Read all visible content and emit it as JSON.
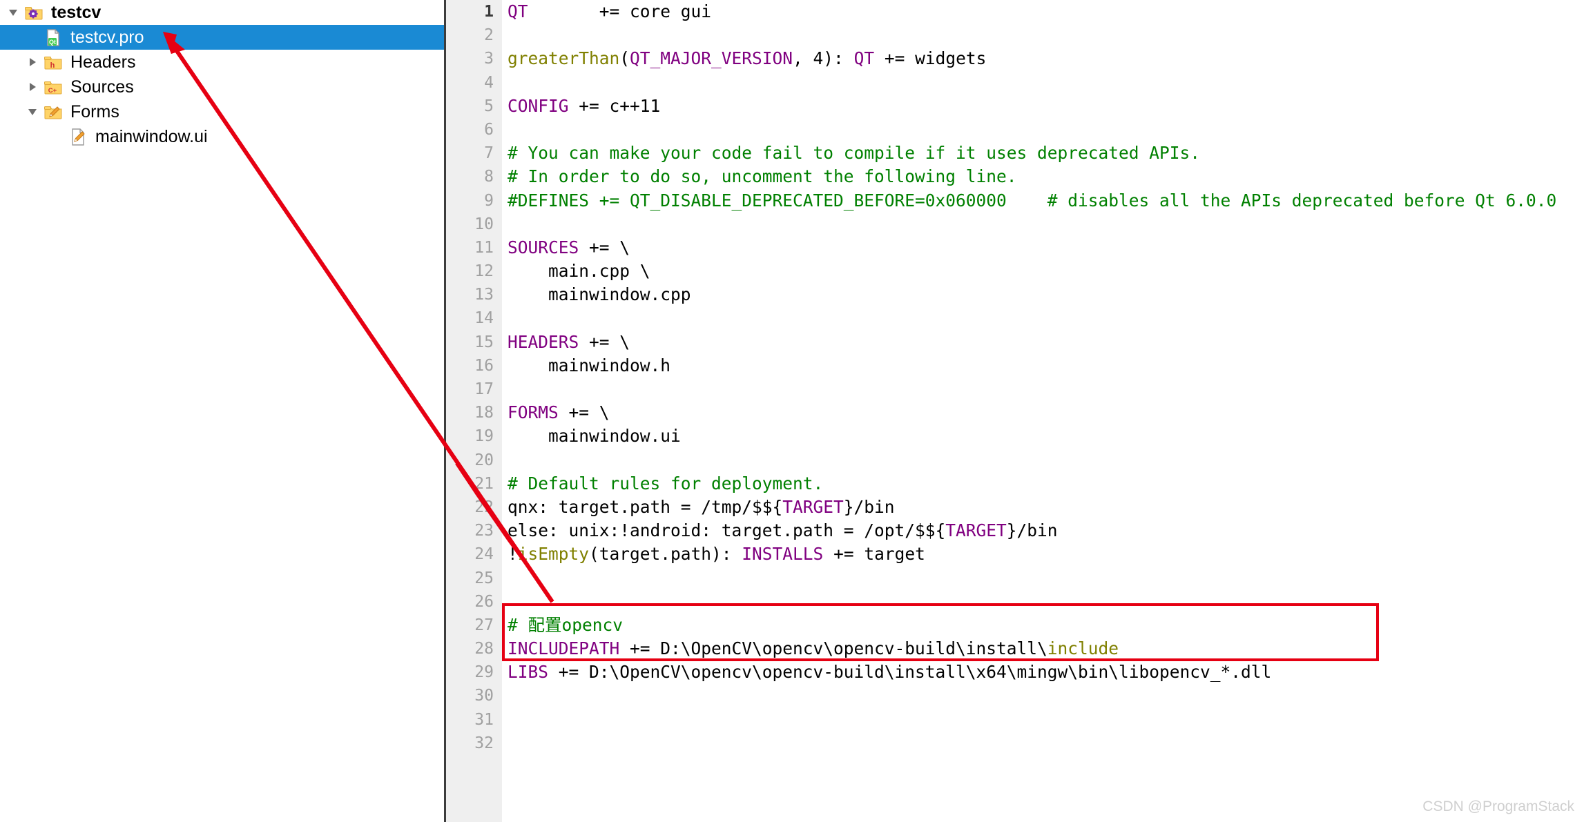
{
  "project_tree": {
    "name": "project-tree-panel",
    "items": [
      {
        "label": "testcv",
        "icon": "qt-project-icon",
        "indent": 0,
        "expander": "down",
        "selected": false,
        "bold": true
      },
      {
        "label": "testcv.pro",
        "icon": "qt-pro-file-icon",
        "indent": 1,
        "expander": "none",
        "selected": true,
        "bold": false
      },
      {
        "label": "Headers",
        "icon": "folder-h-icon",
        "indent": 1,
        "expander": "right",
        "selected": false,
        "bold": false
      },
      {
        "label": "Sources",
        "icon": "folder-cpp-icon",
        "indent": 1,
        "expander": "right",
        "selected": false,
        "bold": false
      },
      {
        "label": "Forms",
        "icon": "folder-ui-icon",
        "indent": 1,
        "expander": "down",
        "selected": false,
        "bold": false
      },
      {
        "label": "mainwindow.ui",
        "icon": "ui-file-icon",
        "indent": 2,
        "expander": "none",
        "selected": false,
        "bold": false
      }
    ]
  },
  "editor": {
    "name": "pro-file-editor",
    "current_line": 1,
    "line_count": 32,
    "lines": [
      {
        "n": 1,
        "tokens": [
          {
            "t": "QT",
            "c": "kw"
          },
          {
            "t": "       += core gui",
            "c": "pl"
          }
        ]
      },
      {
        "n": 2,
        "tokens": []
      },
      {
        "n": 3,
        "tokens": [
          {
            "t": "greaterThan",
            "c": "fn"
          },
          {
            "t": "(",
            "c": "pl"
          },
          {
            "t": "QT_MAJOR_VERSION",
            "c": "kw"
          },
          {
            "t": ", 4): ",
            "c": "pl"
          },
          {
            "t": "QT",
            "c": "kw"
          },
          {
            "t": " += widgets",
            "c": "pl"
          }
        ]
      },
      {
        "n": 4,
        "tokens": []
      },
      {
        "n": 5,
        "tokens": [
          {
            "t": "CONFIG",
            "c": "kw"
          },
          {
            "t": " += c++11",
            "c": "pl"
          }
        ]
      },
      {
        "n": 6,
        "tokens": []
      },
      {
        "n": 7,
        "tokens": [
          {
            "t": "# You can make your code fail to compile if it uses deprecated APIs.",
            "c": "cm"
          }
        ]
      },
      {
        "n": 8,
        "tokens": [
          {
            "t": "# In order to do so, uncomment the following line.",
            "c": "cm"
          }
        ]
      },
      {
        "n": 9,
        "tokens": [
          {
            "t": "#DEFINES += QT_DISABLE_DEPRECATED_BEFORE=0x060000    # disables all the APIs deprecated before Qt 6.0.0",
            "c": "cm"
          }
        ]
      },
      {
        "n": 10,
        "tokens": []
      },
      {
        "n": 11,
        "tokens": [
          {
            "t": "SOURCES",
            "c": "kw"
          },
          {
            "t": " += \\",
            "c": "pl"
          }
        ]
      },
      {
        "n": 12,
        "tokens": [
          {
            "t": "    main.cpp \\",
            "c": "pl"
          }
        ]
      },
      {
        "n": 13,
        "tokens": [
          {
            "t": "    mainwindow.cpp",
            "c": "pl"
          }
        ]
      },
      {
        "n": 14,
        "tokens": []
      },
      {
        "n": 15,
        "tokens": [
          {
            "t": "HEADERS",
            "c": "kw"
          },
          {
            "t": " += \\",
            "c": "pl"
          }
        ]
      },
      {
        "n": 16,
        "tokens": [
          {
            "t": "    mainwindow.h",
            "c": "pl"
          }
        ]
      },
      {
        "n": 17,
        "tokens": []
      },
      {
        "n": 18,
        "tokens": [
          {
            "t": "FORMS",
            "c": "kw"
          },
          {
            "t": " += \\",
            "c": "pl"
          }
        ]
      },
      {
        "n": 19,
        "tokens": [
          {
            "t": "    mainwindow.ui",
            "c": "pl"
          }
        ]
      },
      {
        "n": 20,
        "tokens": []
      },
      {
        "n": 21,
        "tokens": [
          {
            "t": "# Default rules for deployment.",
            "c": "cm"
          }
        ]
      },
      {
        "n": 22,
        "tokens": [
          {
            "t": "qnx: target.path = /tmp/$${",
            "c": "pl"
          },
          {
            "t": "TARGET",
            "c": "kw"
          },
          {
            "t": "}/bin",
            "c": "pl"
          }
        ]
      },
      {
        "n": 23,
        "tokens": [
          {
            "t": "else: unix:!android: target.path = /opt/$${",
            "c": "pl"
          },
          {
            "t": "TARGET",
            "c": "kw"
          },
          {
            "t": "}/bin",
            "c": "pl"
          }
        ]
      },
      {
        "n": 24,
        "tokens": [
          {
            "t": "!",
            "c": "pl"
          },
          {
            "t": "isEmpty",
            "c": "fn"
          },
          {
            "t": "(target.path): ",
            "c": "pl"
          },
          {
            "t": "INSTALLS",
            "c": "kw"
          },
          {
            "t": " += target",
            "c": "pl"
          }
        ]
      },
      {
        "n": 25,
        "tokens": []
      },
      {
        "n": 26,
        "tokens": []
      },
      {
        "n": 27,
        "tokens": [
          {
            "t": "# 配置opencv",
            "c": "cm"
          }
        ]
      },
      {
        "n": 28,
        "tokens": [
          {
            "t": "INCLUDEPATH",
            "c": "kw"
          },
          {
            "t": " += D:\\OpenCV\\opencv\\opencv-build\\install\\",
            "c": "pl"
          },
          {
            "t": "include",
            "c": "fn"
          }
        ]
      },
      {
        "n": 29,
        "tokens": [
          {
            "t": "LIBS",
            "c": "kw"
          },
          {
            "t": " += D:\\OpenCV\\opencv\\opencv-build\\install\\x64\\mingw\\bin\\libopencv_*.dll",
            "c": "pl"
          }
        ]
      },
      {
        "n": 30,
        "tokens": []
      },
      {
        "n": 31,
        "tokens": []
      },
      {
        "n": 32,
        "tokens": []
      }
    ]
  },
  "annotations": {
    "highlight_box_name": "opencv-config-highlight-box",
    "arrow_name": "pointer-arrow",
    "color": "#e60012"
  },
  "watermark": {
    "text": "CSDN @ProgramStack"
  },
  "colors": {
    "selection": "#1a8ad4",
    "keyword": "#800080",
    "function": "#808000",
    "comment": "#008000",
    "gutter_bg": "#efefef",
    "annotation_red": "#e60012"
  }
}
